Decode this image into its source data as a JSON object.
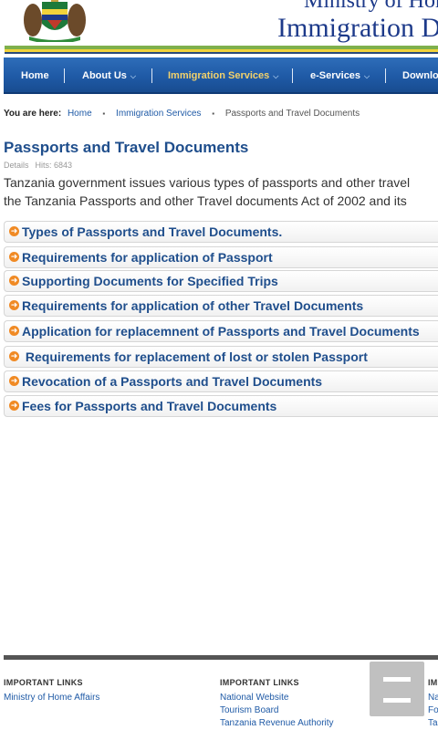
{
  "header": {
    "ministry_name": "Ministry of Home",
    "department_name": "Immigration D"
  },
  "nav": {
    "items": [
      {
        "label": "Home",
        "chevron": false,
        "active": false
      },
      {
        "label": "About Us",
        "chevron": true,
        "active": false
      },
      {
        "label": "Immigration Services",
        "chevron": true,
        "active": true
      },
      {
        "label": "e-Services",
        "chevron": true,
        "active": false
      },
      {
        "label": "Download",
        "chevron": false,
        "active": false
      }
    ],
    "chevron_glyph": "⌵"
  },
  "breadcrumb": {
    "prefix": "You are here:",
    "items": [
      "Home",
      "Immigration Services"
    ],
    "current": "Passports and Travel Documents",
    "separator": "▪"
  },
  "article": {
    "title": "Passports and Travel Documents",
    "details_label": "Details",
    "hits": "Hits: 6843",
    "intro_line1": "Tanzania government issues various types of passports and other travel",
    "intro_line2": "the Tanzania Passports and other Travel documents Act of 2002 and its"
  },
  "accordion": {
    "arrow_glyph": "➜",
    "arrow_color": "#f08a24",
    "items": [
      "Types of Passports and Travel Documents.",
      "Requirements for application of Passport",
      "Supporting Documents for Specified Trips",
      "Requirements for application of other Travel Documents",
      "Application for replacemnent of Passports and Travel Documents",
      " Requirements for replacement of lost or stolen Passport",
      "Revocation of a Passports and Travel Documents",
      "Fees for Passports and Travel Documents"
    ]
  },
  "footer": {
    "columns": [
      {
        "title": "IMPORTANT LINKS",
        "links": [
          "Ministry of Home Affairs"
        ]
      },
      {
        "title": "IMPORTANT LINKS",
        "links": [
          "National Website",
          "Tourism Board",
          "Tanzania Revenue Authority"
        ]
      },
      {
        "title": "IM",
        "links": [
          "Na",
          "Fo",
          "Ta"
        ]
      }
    ]
  },
  "colors": {
    "nav_bg": "#1f5aa6",
    "nav_active": "#f2d16b",
    "title": "#1f4e8c",
    "link": "#1f5aa6"
  }
}
